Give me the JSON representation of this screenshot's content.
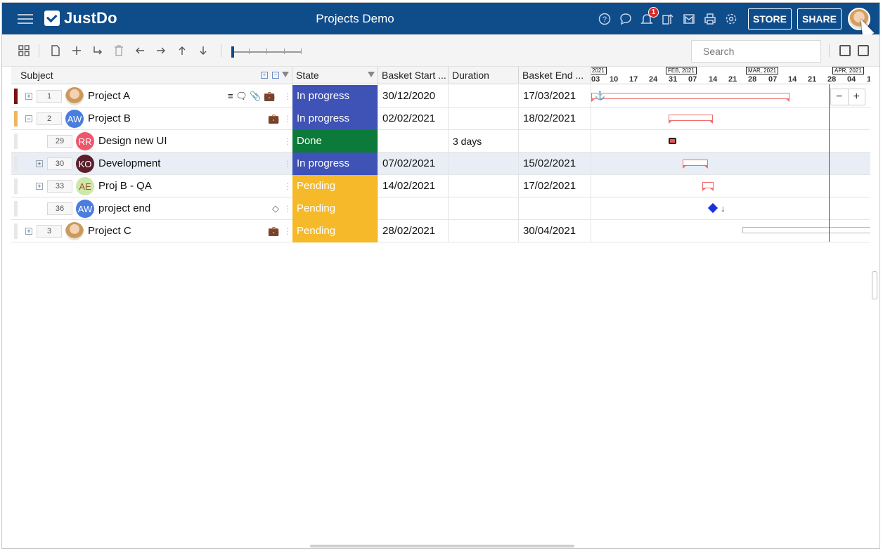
{
  "app": {
    "logo_text": "JustDo",
    "project_title": "Projects Demo",
    "notification_count": "1"
  },
  "header_buttons": {
    "store": "STORE",
    "share": "SHARE"
  },
  "search": {
    "placeholder": "Search"
  },
  "columns": {
    "subject": "Subject",
    "state": "State",
    "basket_start": "Basket Start ...",
    "duration": "Duration",
    "basket_end": "Basket End ..."
  },
  "gantt": {
    "months": [
      "2021",
      "FEB, 2021",
      "MAR, 2021",
      "APR, 2021"
    ],
    "days": [
      "03",
      "10",
      "17",
      "24",
      "31",
      "07",
      "14",
      "21",
      "28",
      "07",
      "14",
      "21",
      "28",
      "04",
      "1"
    ]
  },
  "rows": [
    {
      "seq": "1",
      "subject": "Project A",
      "state": "In progress",
      "start": "30/12/2020",
      "duration": "",
      "end": "17/03/2021",
      "color_bar": "#7a1010",
      "state_color": "#3f52b5"
    },
    {
      "seq": "2",
      "subject": "Project B",
      "avatar": "AW",
      "state": "In progress",
      "start": "02/02/2021",
      "duration": "",
      "end": "18/02/2021",
      "color_bar": "#f0b463",
      "state_color": "#3f52b5"
    },
    {
      "seq": "29",
      "subject": "Design new UI",
      "avatar": "RR",
      "state": "Done",
      "start": "",
      "duration": "3 days",
      "end": "",
      "color_bar": "#e8e8e8",
      "state_color": "#0b7a3a"
    },
    {
      "seq": "30",
      "subject": "Development",
      "avatar": "KO",
      "state": "In progress",
      "start": "07/02/2021",
      "duration": "",
      "end": "15/02/2021",
      "color_bar": "#e8e8e8",
      "state_color": "#3f52b5"
    },
    {
      "seq": "33",
      "subject": "Proj B - QA",
      "avatar": "AE",
      "state": "Pending",
      "start": "14/02/2021",
      "duration": "",
      "end": "17/02/2021",
      "color_bar": "#e8e8e8",
      "state_color": "#f5b92a"
    },
    {
      "seq": "36",
      "subject": "project end",
      "avatar": "AW",
      "state": "Pending",
      "start": "",
      "duration": "",
      "end": "",
      "color_bar": "#e8e8e8",
      "state_color": "#f5b92a"
    },
    {
      "seq": "3",
      "subject": "Project C",
      "state": "Pending",
      "start": "28/02/2021",
      "duration": "",
      "end": "30/04/2021",
      "color_bar": "#e8e8e8",
      "state_color": "#f5b92a"
    }
  ]
}
